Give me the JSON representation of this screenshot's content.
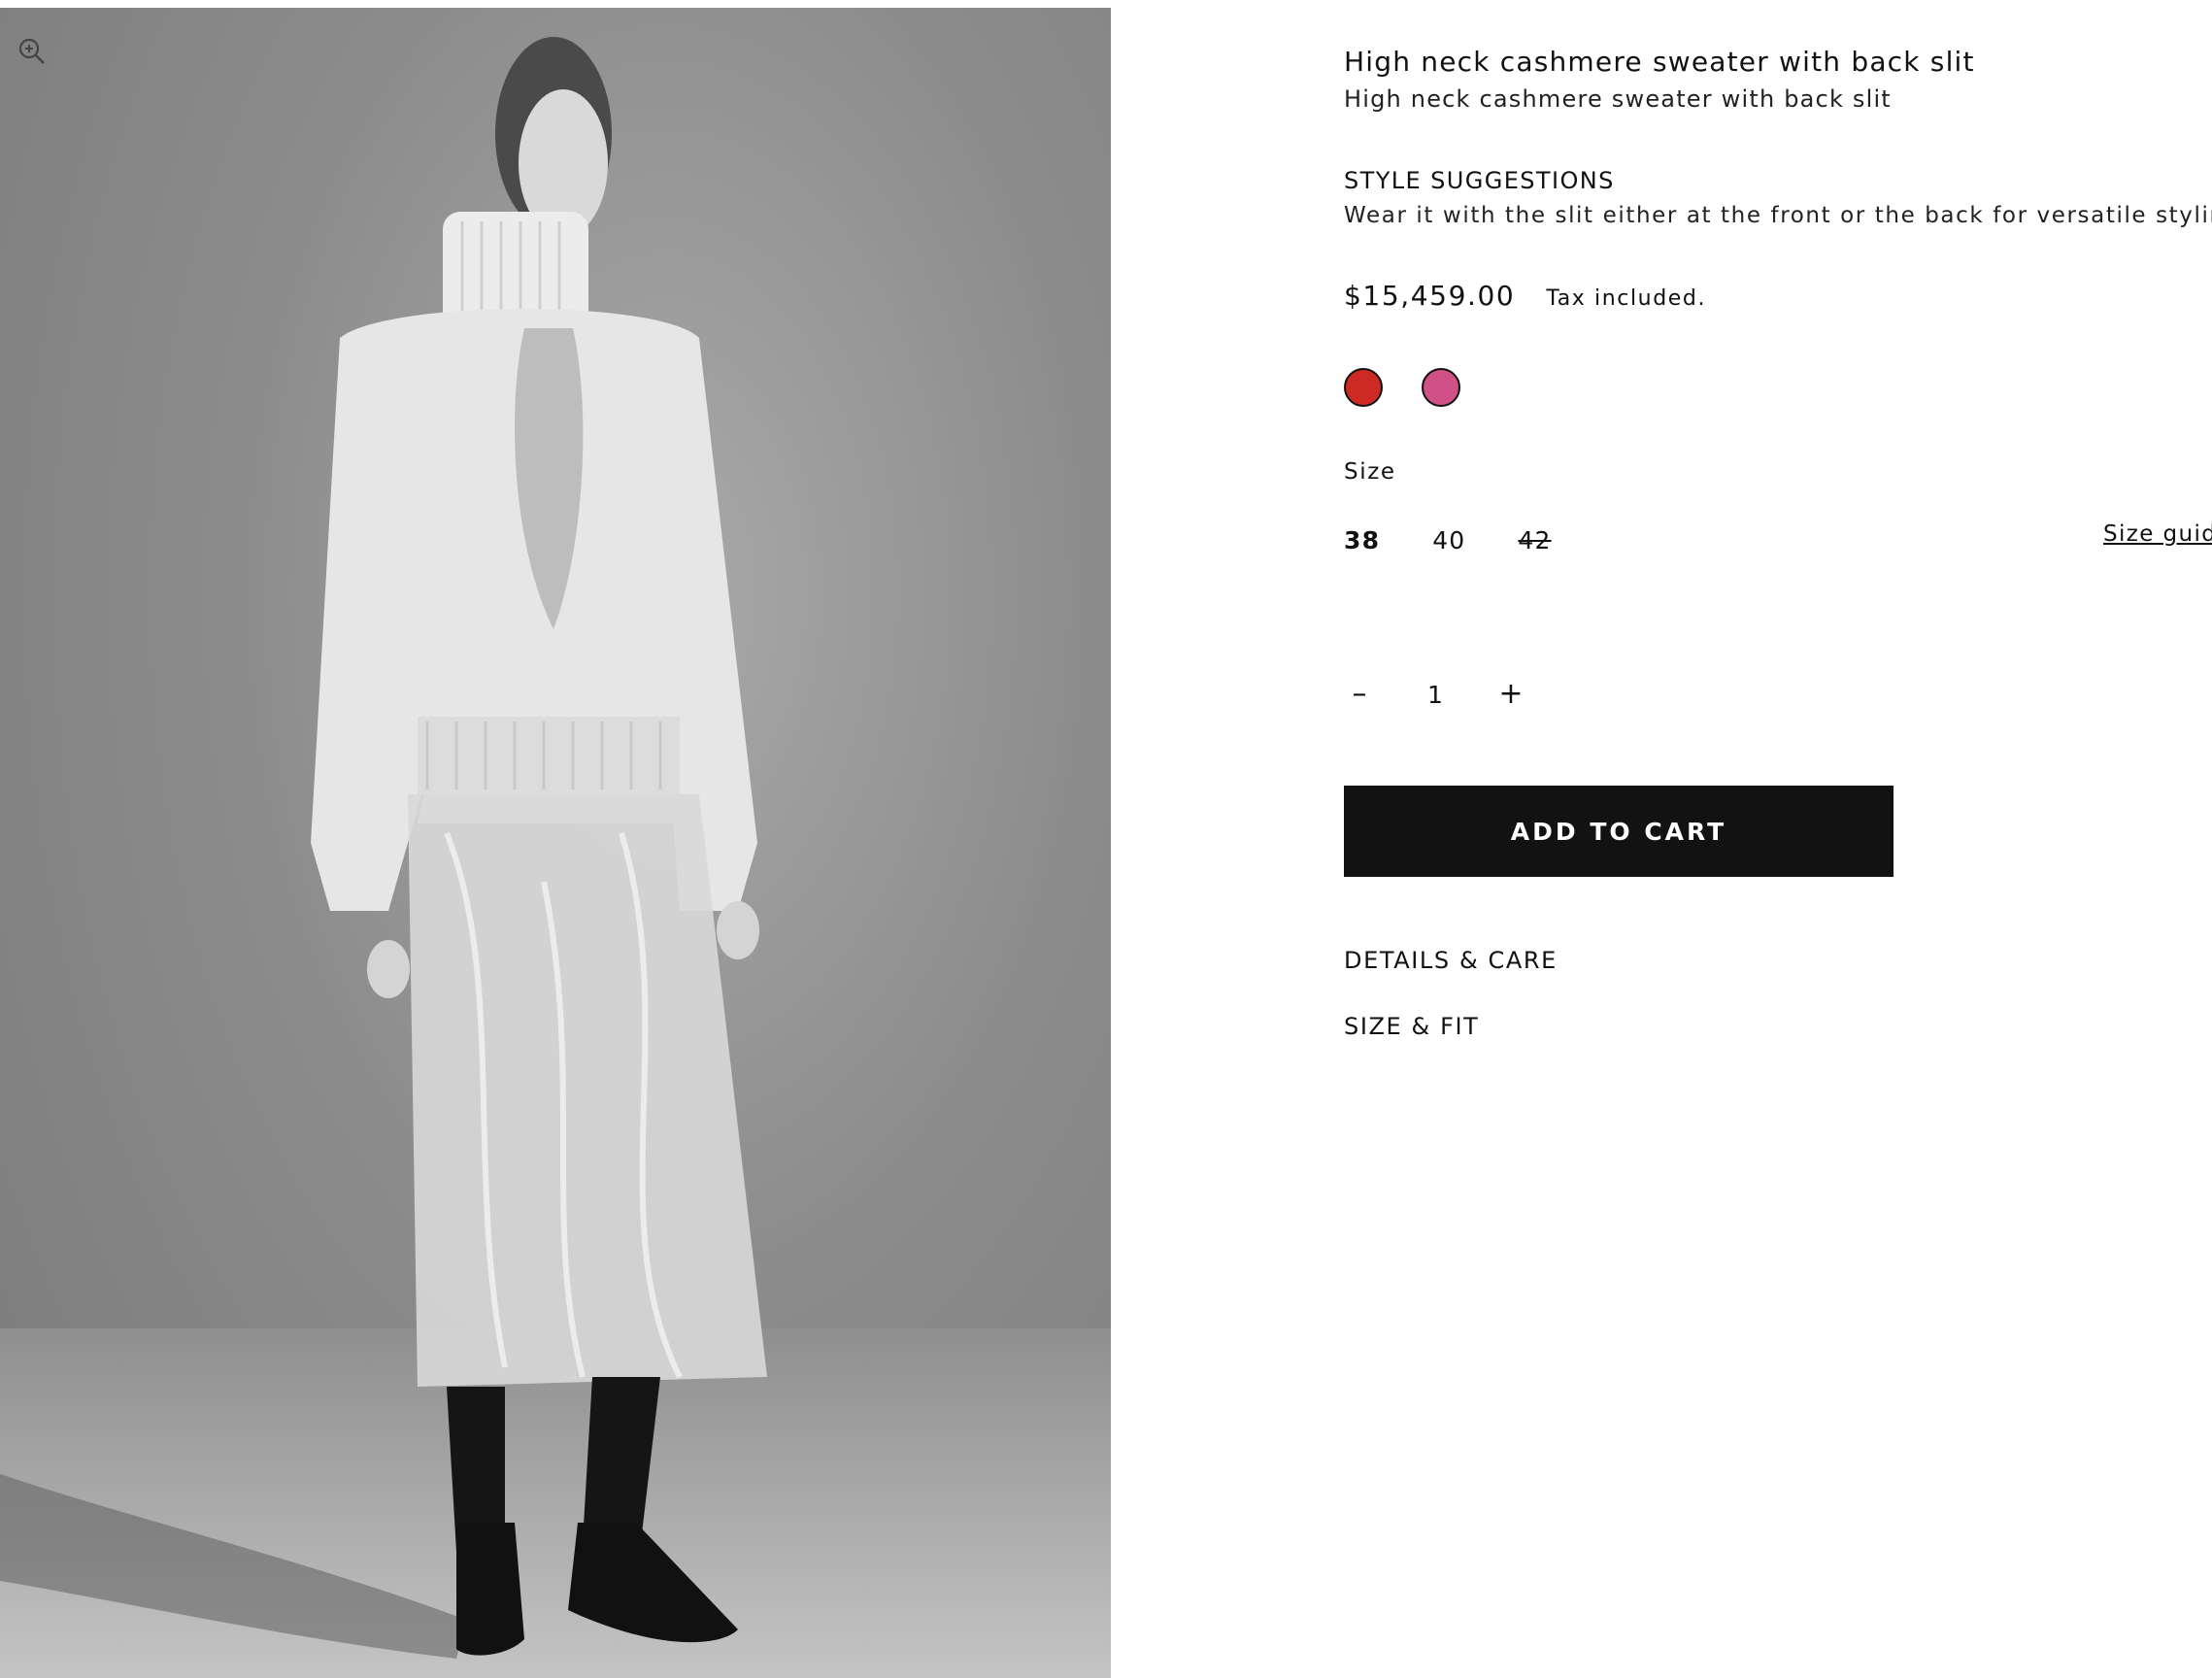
{
  "product": {
    "title": "High neck cashmere sweater with back slit",
    "subtitle": "High neck cashmere sweater with back slit",
    "style_heading": "STYLE SUGGESTIONS",
    "style_text": "Wear it with the slit either at the front or the back for versatile styling options",
    "price": "$15,459.00",
    "tax_note": "Tax included."
  },
  "colors": {
    "swatches": [
      {
        "name": "red-swatch",
        "hex": "#cc2a22"
      },
      {
        "name": "pink-swatch",
        "hex": "#d05088"
      }
    ]
  },
  "sizes": {
    "label": "Size",
    "options": [
      {
        "label": "38",
        "state": "selected"
      },
      {
        "label": "40",
        "state": "available"
      },
      {
        "label": "42",
        "state": "sold-out"
      }
    ],
    "guide_link": "Size guide"
  },
  "quantity": {
    "minus": "–",
    "value": "1",
    "plus": "+"
  },
  "cart": {
    "add_label": "ADD TO CART"
  },
  "accordions": {
    "details": "DETAILS & CARE",
    "size_fit": "SIZE & FIT"
  },
  "icons": {
    "zoom": "zoom-in-icon"
  }
}
